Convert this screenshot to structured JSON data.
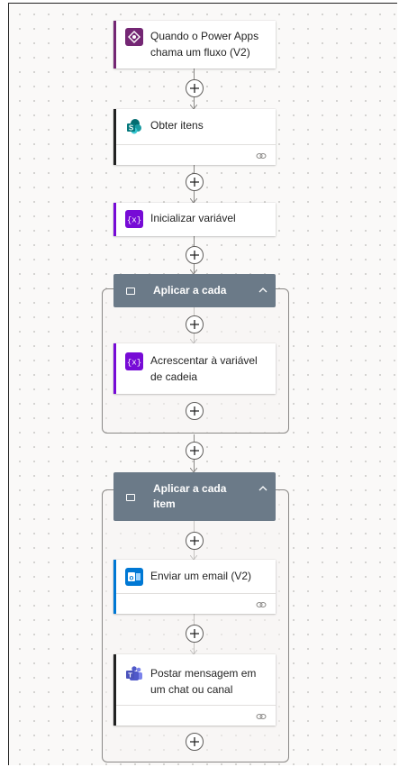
{
  "flow": {
    "trigger": {
      "title": "Quando o Power Apps chama um fluxo (V2)",
      "icon": "power-apps-icon",
      "color": "#742774"
    },
    "get_items": {
      "title": "Obter itens",
      "icon": "sharepoint-icon",
      "color": "#036c70"
    },
    "init_var": {
      "title": "Inicializar variável",
      "icon": "variable-icon",
      "color": "#770bd6"
    },
    "apply_each_1": {
      "label": "Aplicar a cada",
      "append_var": {
        "title": "Acrescentar à variável de cadeia",
        "icon": "variable-icon",
        "color": "#770bd6"
      }
    },
    "apply_each_2": {
      "label": "Aplicar a cada item",
      "send_email": {
        "title": "Enviar um email (V2)",
        "icon": "outlook-icon",
        "color": "#0078d4"
      },
      "post_message": {
        "title": "Postar mensagem em um chat ou canal",
        "icon": "teams-icon",
        "color": "#4b53bc"
      }
    }
  },
  "colors": {
    "scope_header": "#6b7a88",
    "canvas": "#faf9f8",
    "connector": "#8a8886"
  }
}
